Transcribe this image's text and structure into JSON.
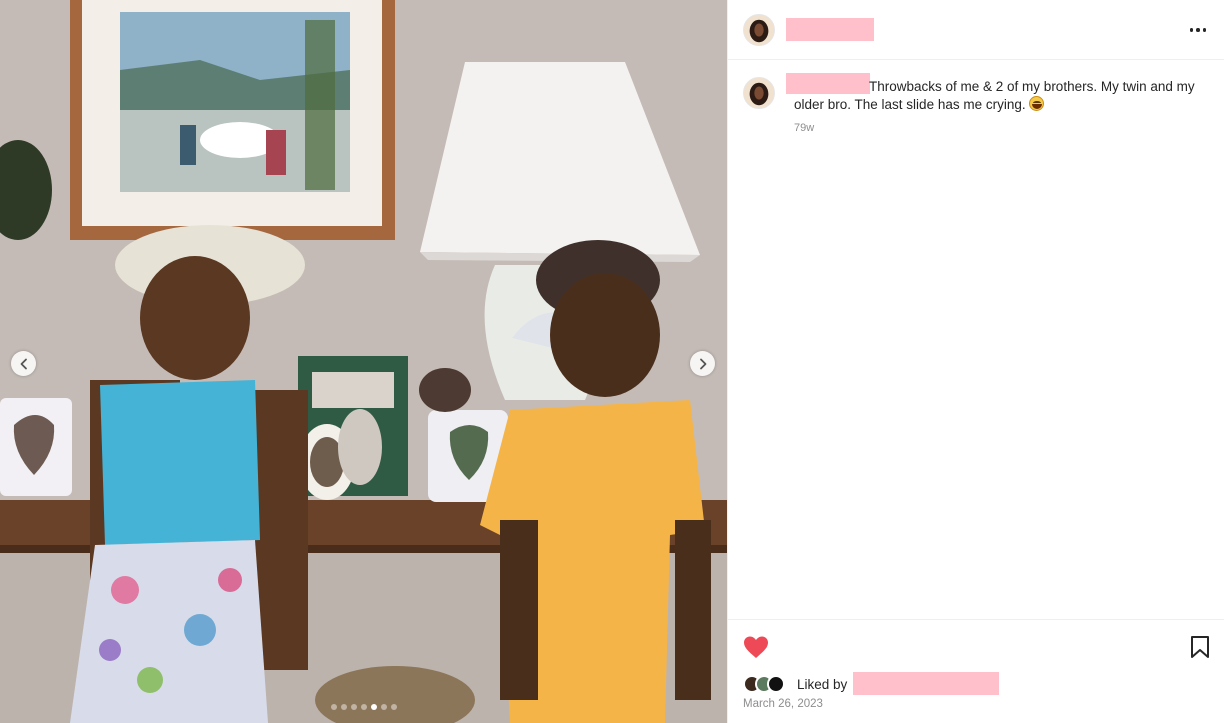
{
  "post": {
    "caption": "Throwbacks of me & 2 of my brothers. My twin and my older bro. The last slide has me crying.",
    "caption_emoji": "grinning-squinting-face-emoji",
    "time_ago": "79w",
    "liked_by_prefix": "Liked by",
    "date": "March 26, 2023"
  },
  "carousel": {
    "total_slides": 7,
    "active_slide": 5
  },
  "colors": {
    "heart": "#ed4956",
    "redaction": "#ffc0cb",
    "muted_text": "#8e8e8e"
  },
  "icons": {
    "prev": "chevron-left-icon",
    "next": "chevron-right-icon",
    "more": "more-options-icon",
    "like": "heart-icon",
    "save": "bookmark-icon"
  }
}
